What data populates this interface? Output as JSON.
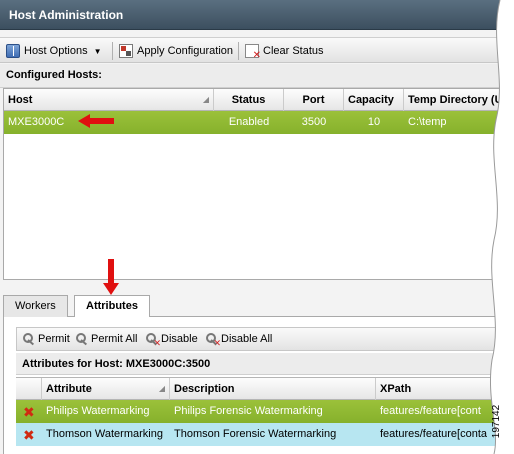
{
  "window": {
    "title": "Host Administration"
  },
  "toolbar": {
    "host_options": "Host Options",
    "apply_config": "Apply Configuration",
    "clear_status": "Clear Status"
  },
  "configured_hosts": {
    "label": "Configured Hosts:",
    "columns": [
      "Host",
      "Status",
      "Port",
      "Capacity",
      "Temp Directory (UI"
    ],
    "rows": [
      {
        "host": "MXE3000C",
        "status": "Enabled",
        "port": "3500",
        "capacity": "10",
        "temp_dir": "C:\\temp"
      }
    ]
  },
  "tabs": {
    "workers": "Workers",
    "attributes": "Attributes",
    "active": "Attributes"
  },
  "attributes": {
    "actions": {
      "permit": "Permit",
      "permit_all": "Permit All",
      "disable": "Disable",
      "disable_all": "Disable All"
    },
    "title": "Attributes for Host: MXE3000C:3500",
    "columns": [
      "Attribute",
      "Description",
      "XPath"
    ],
    "rows": [
      {
        "attribute": "Philips Watermarking",
        "description": "Philips Forensic Watermarking",
        "xpath": "features/feature[cont"
      },
      {
        "attribute": "Thomson Watermarking",
        "description": "Thomson Forensic Watermarking",
        "xpath": "features/feature[conta"
      }
    ]
  },
  "figure_number": "197142",
  "colors": {
    "selected_row": "#8db832",
    "alt_row": "#b7e6f1",
    "titlebar": "#4a5e6e",
    "arrow": "#e01010"
  }
}
